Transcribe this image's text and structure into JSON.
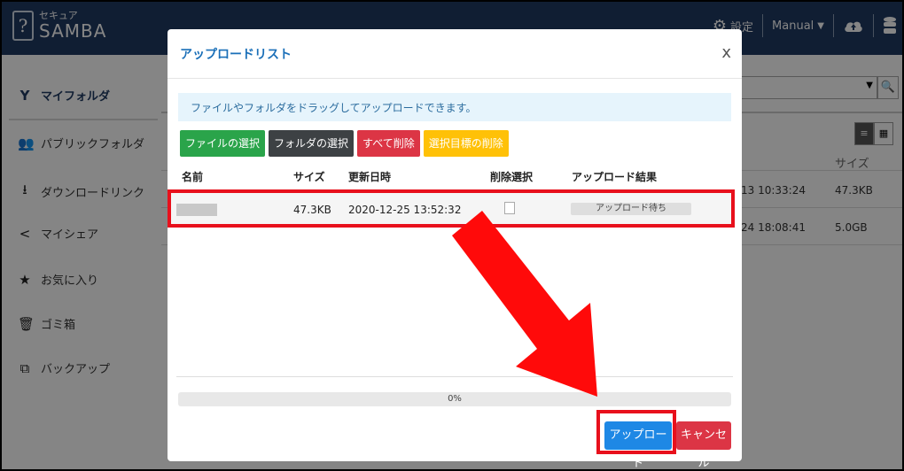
{
  "header": {
    "logo_glyph": "?",
    "logo_sub": "セキュア",
    "logo_main": "SAMBA",
    "settings_label": "設定",
    "manual_label": "Manual"
  },
  "sidebar": {
    "items": [
      {
        "label": "マイフォルダ",
        "icon": "tie-icon"
      },
      {
        "label": "パブリックフォルダ",
        "icon": "users-icon"
      },
      {
        "label": "ダウンロードリンク",
        "icon": "download-icon"
      },
      {
        "label": "マイシェア",
        "icon": "share-icon"
      },
      {
        "label": "お気に入り",
        "icon": "star-icon"
      },
      {
        "label": "ゴミ箱",
        "icon": "trash-icon"
      },
      {
        "label": "バックアップ",
        "icon": "backup-icon"
      }
    ]
  },
  "background": {
    "size_header": "サイズ",
    "rows": [
      {
        "date": "13 10:33:24",
        "size": "47.3KB"
      },
      {
        "date": "24 18:08:41",
        "size": "5.0GB"
      }
    ]
  },
  "modal": {
    "title": "アップロードリスト",
    "close": "x",
    "info": "ファイルやフォルダをドラッグしてアップロードできます。",
    "buttons": {
      "select_file": "ファイルの選択",
      "select_folder": "フォルダの選択",
      "delete_all": "すべて削除",
      "delete_selected": "選択目標の削除"
    },
    "columns": {
      "name": "名前",
      "size": "サイズ",
      "updated": "更新日時",
      "delete_select": "削除選択",
      "result": "アップロード結果"
    },
    "row": {
      "size": "47.3KB",
      "updated": "2020-12-25 13:52:32",
      "status": "アップロード待ち"
    },
    "progress": "0%",
    "upload_button": "アップロード",
    "cancel_button": "キャンセル"
  },
  "colors": {
    "header_bg": "#1f3a63",
    "highlight": "#e8101c",
    "upload_btn": "#1e88e5",
    "cancel_btn": "#dc3545"
  }
}
